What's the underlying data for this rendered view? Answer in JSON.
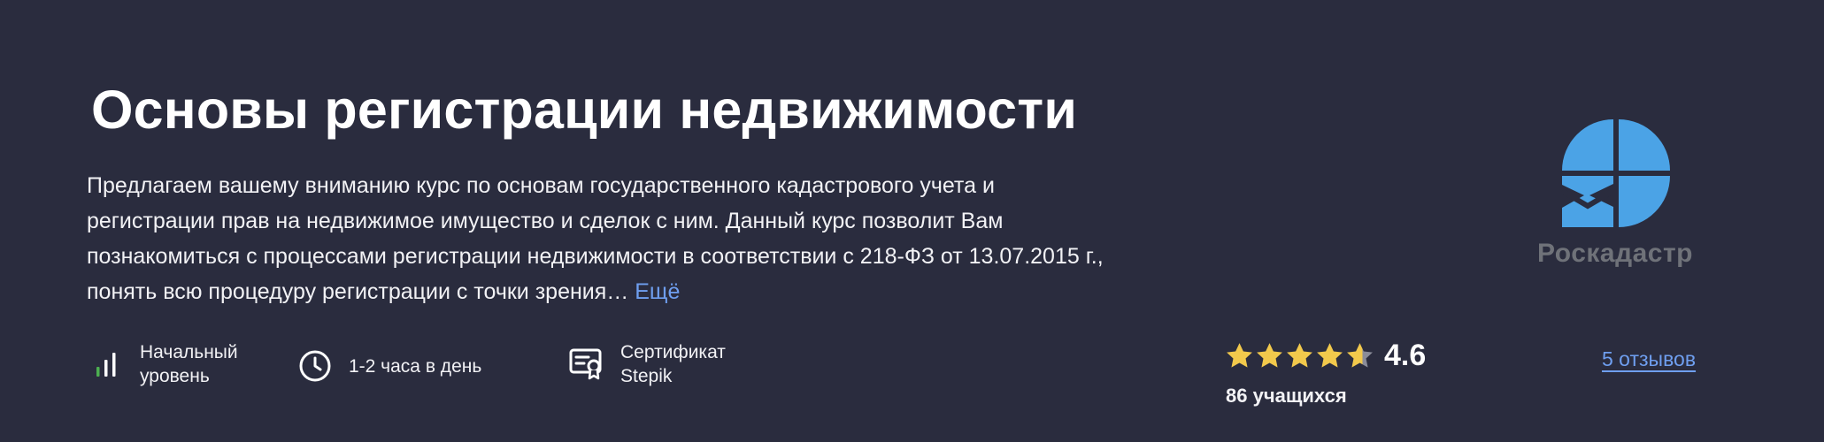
{
  "course": {
    "title": "Основы регистрации недвижимости",
    "description": "Предлагаем вашему вниманию курс по основам государственного кадастрового учета и регистрации прав на недвижимое имущество и сделок с ним. Данный курс позволит Вам познакомиться с процессами регистрации недвижимости в соответствии с 218-ФЗ от 13.07.2015 г., понять всю процедуру регистрации с точки зрения…",
    "more_label": "Ещё"
  },
  "features": {
    "level": {
      "line1": "Начальный",
      "line2": "уровень",
      "icon": "level-bars-icon"
    },
    "time": {
      "label": "1-2 часа в день",
      "icon": "clock-icon"
    },
    "certificate": {
      "line1": "Сертификат",
      "line2": "Stepik",
      "icon": "certificate-icon"
    }
  },
  "rating": {
    "value": "4.6",
    "stars": 4.6,
    "learners": "86 учащихся",
    "reviews_label": "5 отзывов"
  },
  "author": {
    "name": "Роскадастр"
  },
  "colors": {
    "background": "#2a2c3e",
    "link": "#6f9ff0",
    "star": "#f2c94c",
    "level_active": "#4caf50",
    "logo_blue": "#4ba3e6"
  }
}
